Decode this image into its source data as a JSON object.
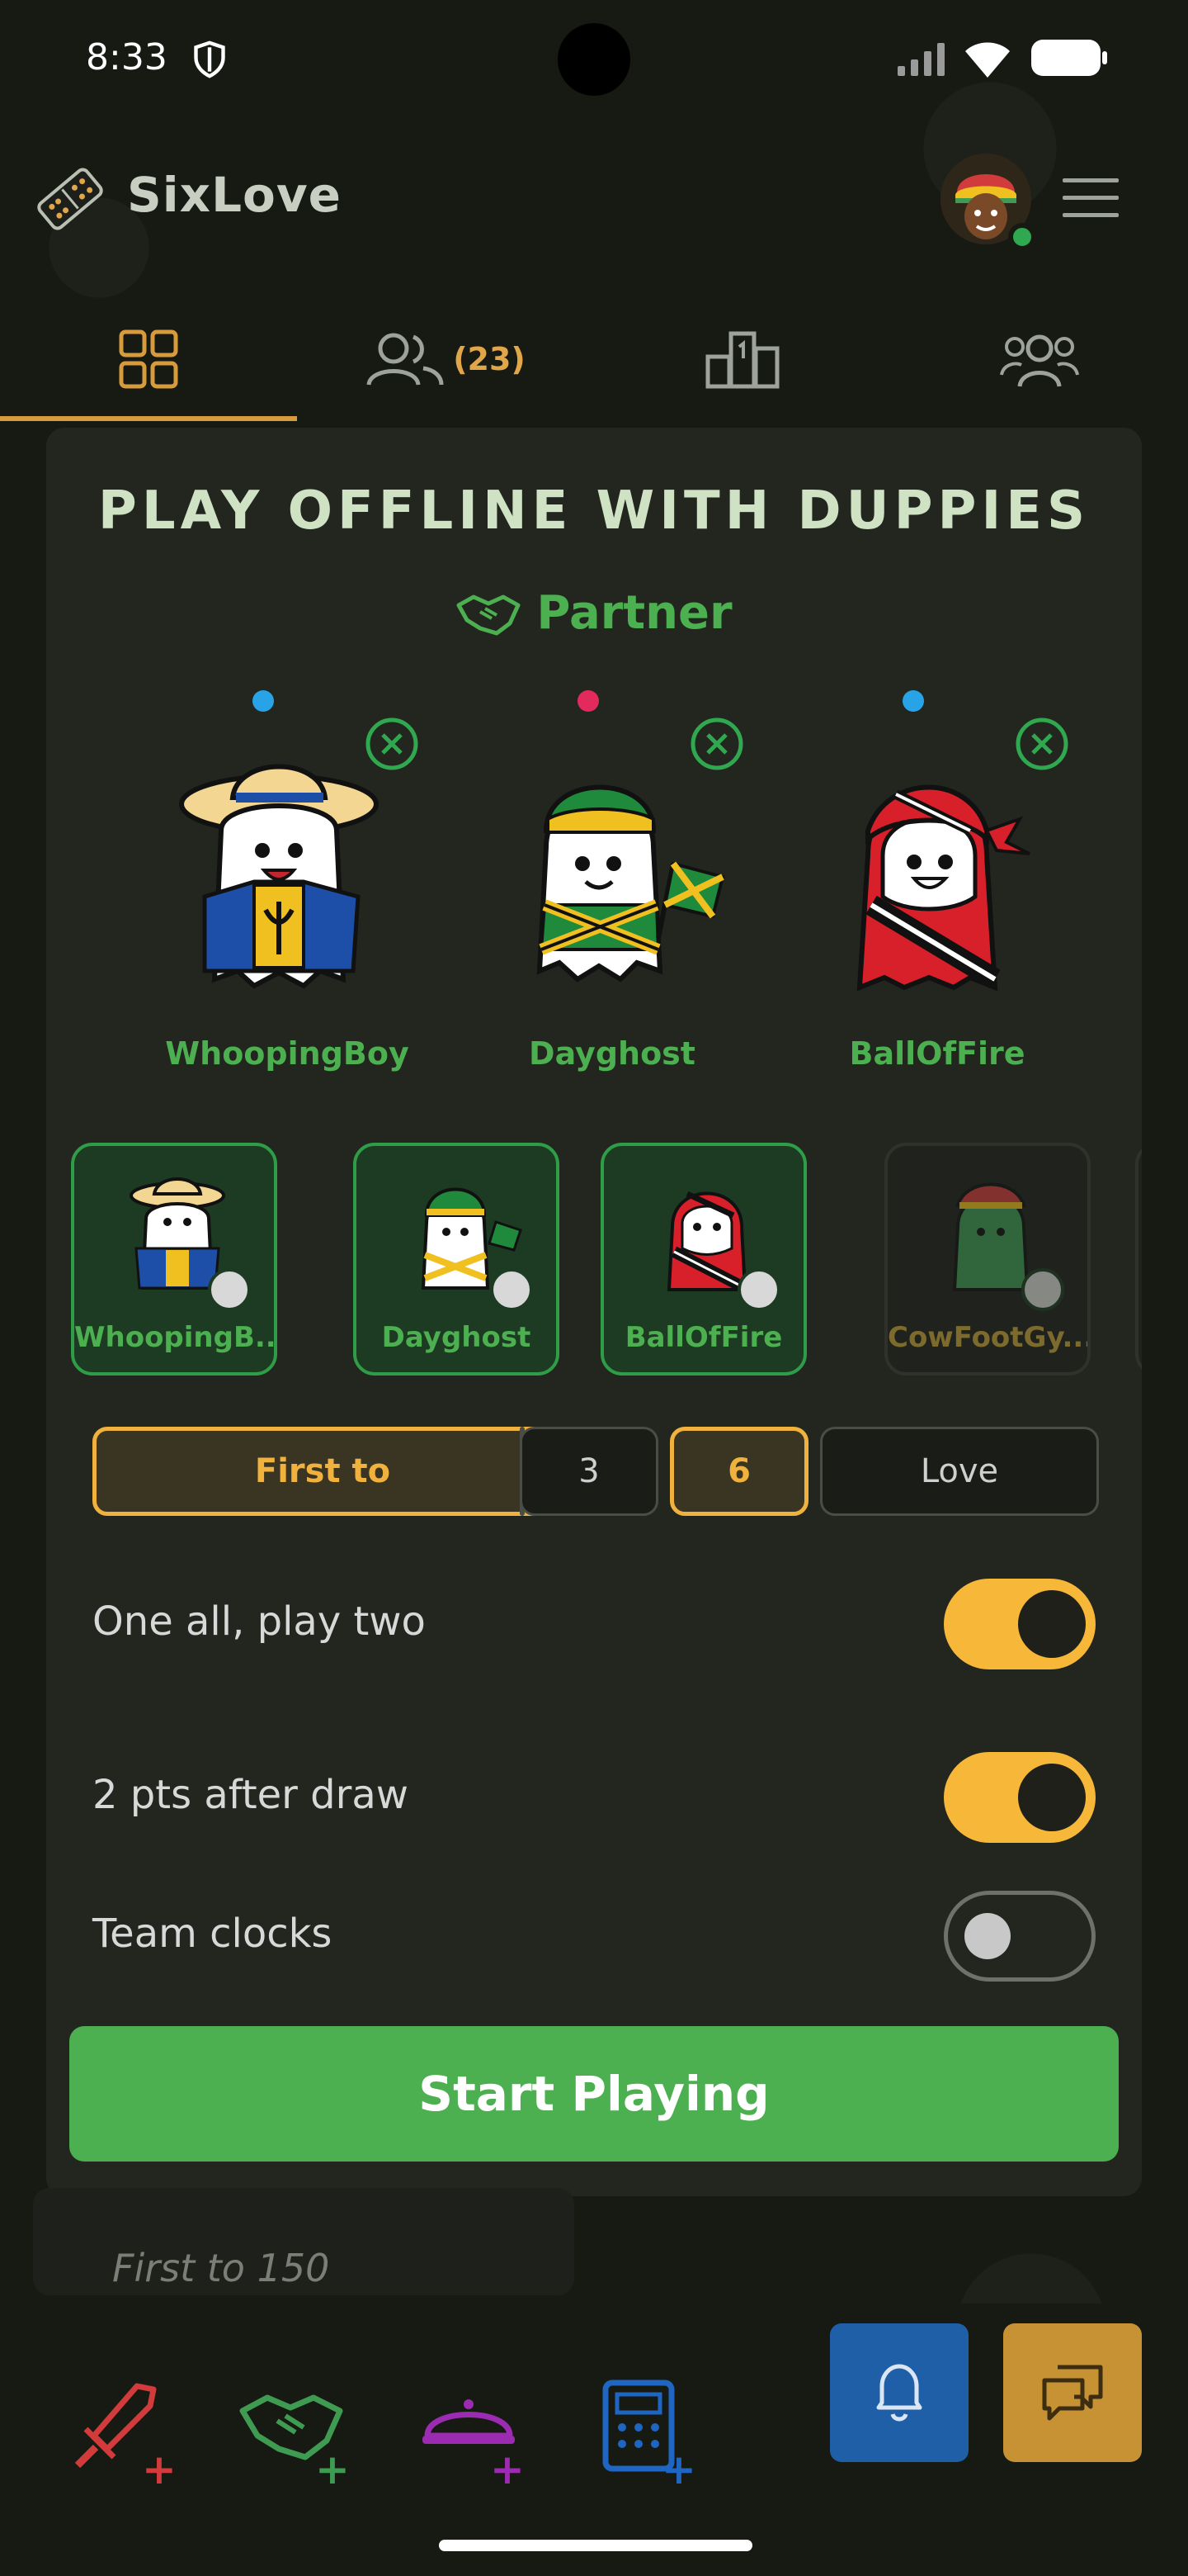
{
  "status_bar": {
    "time": "8:33"
  },
  "header": {
    "app_title": "SixLove"
  },
  "tabs": [
    {
      "id": "lobby",
      "active": true
    },
    {
      "id": "friends",
      "count": "(23)"
    },
    {
      "id": "leaderboard"
    },
    {
      "id": "community"
    }
  ],
  "card": {
    "title": "PLAY OFFLINE WITH DUPPIES",
    "mode": "Partner",
    "seats": [
      {
        "name": "WhoopingBoy",
        "team_color": "#29a3e8"
      },
      {
        "name": "Dayghost",
        "team_color": "#e22a5d"
      },
      {
        "name": "BallOfFire",
        "team_color": "#29a3e8"
      }
    ],
    "roster": [
      {
        "name": "WhoopingB...",
        "selected": true
      },
      {
        "name": "Dayghost",
        "selected": true
      },
      {
        "name": "BallOfFire",
        "selected": true
      },
      {
        "name": "CowFootGy...",
        "selected": false
      }
    ],
    "score_options": {
      "first_to": "First to",
      "three": "3",
      "six": "6",
      "love": "Love",
      "selected": [
        "First to",
        "6"
      ]
    },
    "toggles": [
      {
        "label": "One all, play two",
        "on": true
      },
      {
        "label": "2 pts after draw",
        "on": true
      },
      {
        "label": "Team clocks",
        "on": false
      }
    ],
    "start_button": "Start Playing"
  },
  "peek": {
    "text": "First to 150"
  },
  "colors": {
    "accent_gold": "#f0b23c",
    "green": "#4caf50",
    "bell_blue": "#1f5fa8",
    "chat_gold": "#c69233"
  },
  "bottom_nav": [
    {
      "icon": "sword-icon",
      "color": "#d23b3b"
    },
    {
      "icon": "handshake-icon",
      "color": "#3f9a52"
    },
    {
      "icon": "dish-icon",
      "color": "#9b2bb0"
    },
    {
      "icon": "calculator-icon",
      "color": "#1f66c2"
    }
  ]
}
